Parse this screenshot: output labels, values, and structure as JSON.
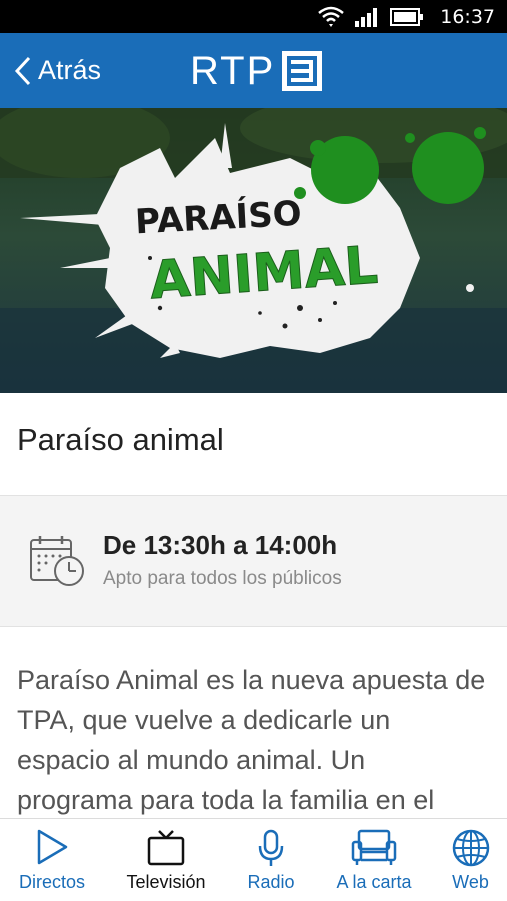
{
  "status_bar": {
    "time": "16:37"
  },
  "header": {
    "back_label": "Atrás",
    "logo_text": "RTP"
  },
  "hero": {
    "logo_line1": "PARAÍSO",
    "logo_line2": "ANIMAL"
  },
  "program": {
    "title": "Paraíso animal",
    "time_range": "De 13:30h a 14:00h",
    "rating": "Apto para todos los públicos",
    "description": "Paraíso Animal es la nueva apuesta de TPA, que vuelve a dedicarle un espacio al mundo animal. Un programa para toda la familia en el"
  },
  "bottom_nav": {
    "items": [
      {
        "label": "Directos",
        "icon": "play-icon"
      },
      {
        "label": "Televisión",
        "icon": "tv-icon"
      },
      {
        "label": "Radio",
        "icon": "microphone-icon"
      },
      {
        "label": "A la carta",
        "icon": "sofa-icon"
      },
      {
        "label": "Web",
        "icon": "globe-icon"
      }
    ],
    "active": "Televisión"
  },
  "colors": {
    "brand_blue": "#1a6db8",
    "text_dark": "#222222",
    "text_muted": "#8a8a8a"
  }
}
